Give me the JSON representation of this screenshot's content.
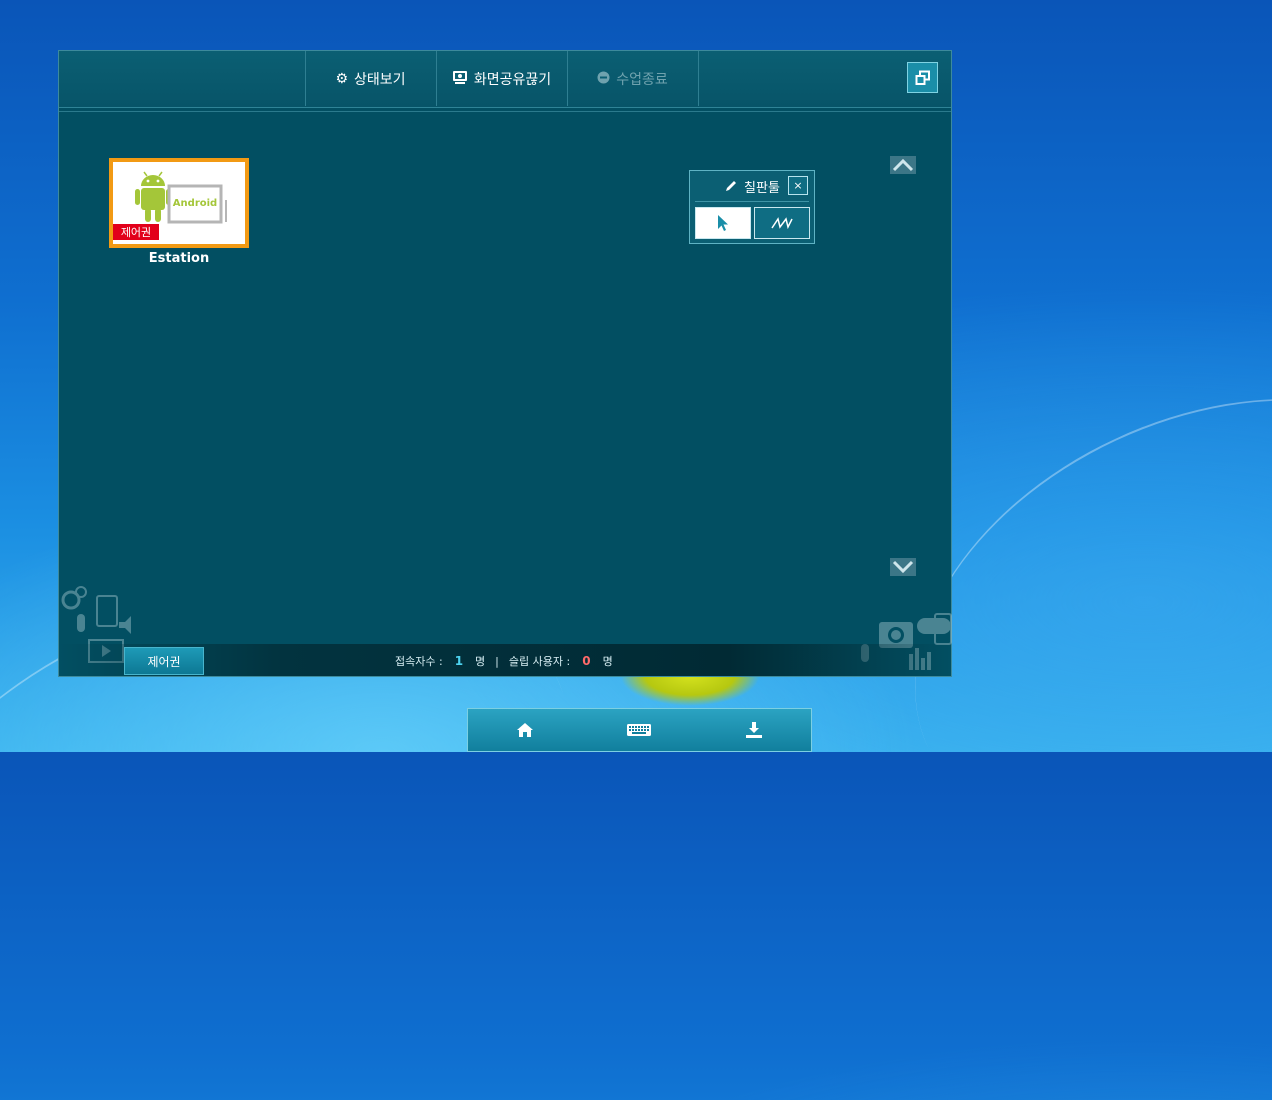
{
  "toolbar": {
    "status_label": "상태보기",
    "share_off_label": "화면공유끊기",
    "end_class_label": "수업종료"
  },
  "device": {
    "thumb_text": "Android",
    "badge": "제어권",
    "name": "Estation"
  },
  "chalkboard": {
    "title": "칠판툴",
    "close": "×"
  },
  "statusbar": {
    "control_button": "제어권",
    "connected_label": "접속자수 :",
    "connected_count": "1",
    "connected_unit": "명",
    "separator": "|",
    "sleep_label": "슬립 사용자 :",
    "sleep_count": "0",
    "sleep_unit": "명"
  },
  "icons": {
    "status": "gear-icon",
    "share": "monitor-icon",
    "end": "minus-circle-icon",
    "restore": "restore-window-icon",
    "pointer": "cursor-icon",
    "pen": "pen-stroke-icon",
    "dock": [
      "home-icon",
      "keyboard-icon",
      "download-icon"
    ]
  },
  "colors": {
    "panel": "#024f62",
    "tile_border": "#f29a14",
    "badge": "#e2001a",
    "android_green": "#a4c639"
  }
}
